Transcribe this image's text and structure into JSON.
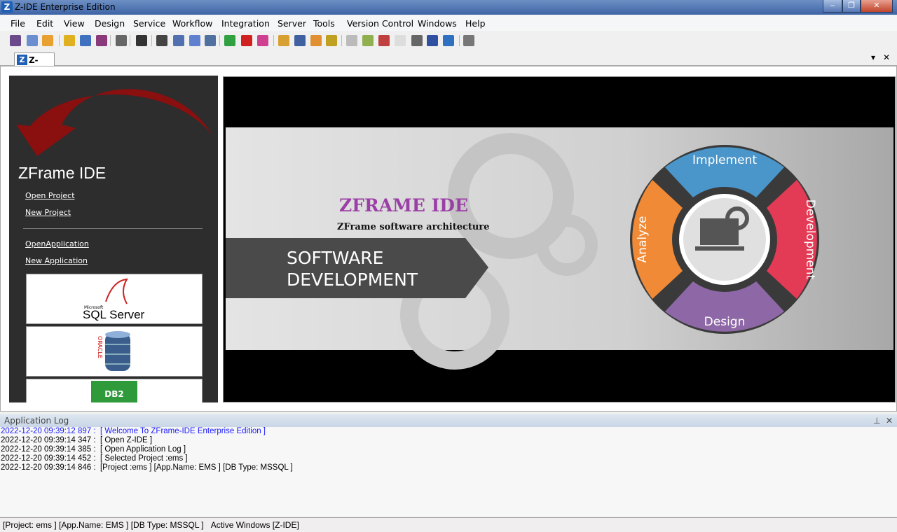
{
  "window": {
    "title": "Z-IDE Enterprise Edition",
    "logo": "Z",
    "minimize": "‒",
    "restore": "❐",
    "close": "✕"
  },
  "menu": [
    "File",
    "Edit",
    "View",
    "Design",
    "Service",
    "Workflow",
    "Integration",
    "Server",
    "Tools",
    "Version Control",
    "Windows",
    "Help"
  ],
  "toolbar_icons": [
    "new-form",
    "window-edit",
    "users",
    "database",
    "report",
    "wrench",
    "script",
    "terminal",
    "layout",
    "network",
    "monitor",
    "document-list",
    "shuffle",
    "run",
    "palette",
    "folder-tree",
    "tree",
    "people",
    "key-lock",
    "cube",
    "map",
    "cubes",
    "window",
    "connector",
    "window-pin",
    "chart",
    "export"
  ],
  "tabs": [
    {
      "label": "Z-IDE",
      "icon": "Z"
    }
  ],
  "tab_controls": {
    "dropdown": "▾",
    "close": "✕"
  },
  "sidebar": {
    "title": "ZFrame IDE",
    "links": [
      "Open Project",
      "New Project",
      "OpenApplication",
      "New Application"
    ],
    "databases": [
      {
        "name": "SQL Server",
        "vendor": "Microsoft"
      },
      {
        "name": "ORACLE"
      },
      {
        "name": "DB2"
      }
    ]
  },
  "banner": {
    "title": "ZFRAME IDE",
    "subtitle": "ZFrame software architecture",
    "tag_line1": "SOFTWARE",
    "tag_line2": "DEVELOPMENT",
    "cycle": [
      {
        "label": "Implement",
        "color": "#4a95c9"
      },
      {
        "label": "Development",
        "color": "#e33a55"
      },
      {
        "label": "Design",
        "color": "#8e68a6"
      },
      {
        "label": "Analyze",
        "color": "#f08a36"
      }
    ]
  },
  "log": {
    "title": "Application Log",
    "pin": "⊥",
    "close": "✕",
    "entries": [
      {
        "time": "2022-12-20 09:39:12 897 :",
        "msg": "[ Welcome To ZFrame-IDE Enterprise Edition ]",
        "color": "#1a1aff"
      },
      {
        "time": "2022-12-20 09:39:14 347 :",
        "msg": "[ Open Z-IDE ]",
        "color": "#000000"
      },
      {
        "time": "2022-12-20 09:39:14 385 :",
        "msg": "[ Open Application Log ]",
        "color": "#000000"
      },
      {
        "time": "2022-12-20 09:39:14 452 :",
        "msg": "[ Selected Project :ems ]",
        "color": "#000000"
      },
      {
        "time": "2022-12-20 09:39:14 846 :",
        "msg": "[Project :ems ] [App.Name: EMS ] [DB Type: MSSQL ]",
        "color": "#000000"
      }
    ]
  },
  "status": {
    "text": "[Project: ems ] [App.Name: EMS ] [DB Type: MSSQL ]",
    "active": "Active Windows [Z-IDE]"
  }
}
